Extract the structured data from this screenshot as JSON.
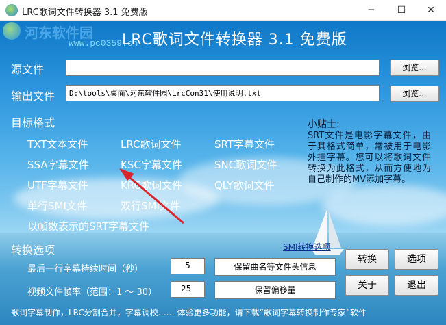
{
  "window": {
    "title": "LRC歌词文件转换器 3.1 免费版",
    "min": "─",
    "max": "☐",
    "close": "✕"
  },
  "watermark": {
    "text": "河东软件园",
    "url": "www.pc0359.cn"
  },
  "header": {
    "title": "LRC歌词文件转换器  3.1  免费版"
  },
  "source": {
    "label": "源文件",
    "value": "",
    "browse_label": "浏览..."
  },
  "output": {
    "label": "输出文件",
    "value": "D:\\tools\\桌面\\河东软件园\\LrcCon31\\使用说明.txt",
    "browse_label": "浏览..."
  },
  "formats": {
    "label": "目标格式",
    "items": [
      "TXT文本文件",
      "LRC歌词文件",
      "SRT字幕文件",
      "SSA字幕文件",
      "KSC字幕文件",
      "SNC歌词文件",
      "UTF字幕文件",
      "KRC歌词文件",
      "QLY歌词文件",
      "单行SMI文件",
      "双行SMI文件",
      "以帧数表示的SRT字幕文件"
    ]
  },
  "tip": {
    "title": "小贴士:",
    "body": "SRT文件是电影字幕文件，由于其格式简单，常被用于电影外挂字幕。您可以将歌词文件转换为此格式，从而方便地为自己制作的MV添加字幕。"
  },
  "options": {
    "label": "转换选项",
    "smi_link": "SMI转换选项",
    "last_line_label": "最后一行字幕持续时间（秒）",
    "last_line_value": "5",
    "frame_rate_label": "视频文件帧率（范围：1 ～ 30）",
    "frame_rate_value": "25",
    "keep_header_label": "保留曲名等文件头信息",
    "keep_offset_label": "保留偏移量"
  },
  "actions": {
    "convert": "转换",
    "options": "选项",
    "about": "关于",
    "exit": "退出"
  },
  "footer": {
    "text": "歌词字幕制作，LRC分割合并，字幕调校……  体验更多功能，请下载“歌词字幕转换制作专家”软件"
  },
  "colors": {
    "accent_blue": "#0f78c8",
    "annotation_arrow": "#d9262c"
  },
  "icons": [
    "app-icon",
    "boat-icon"
  ]
}
